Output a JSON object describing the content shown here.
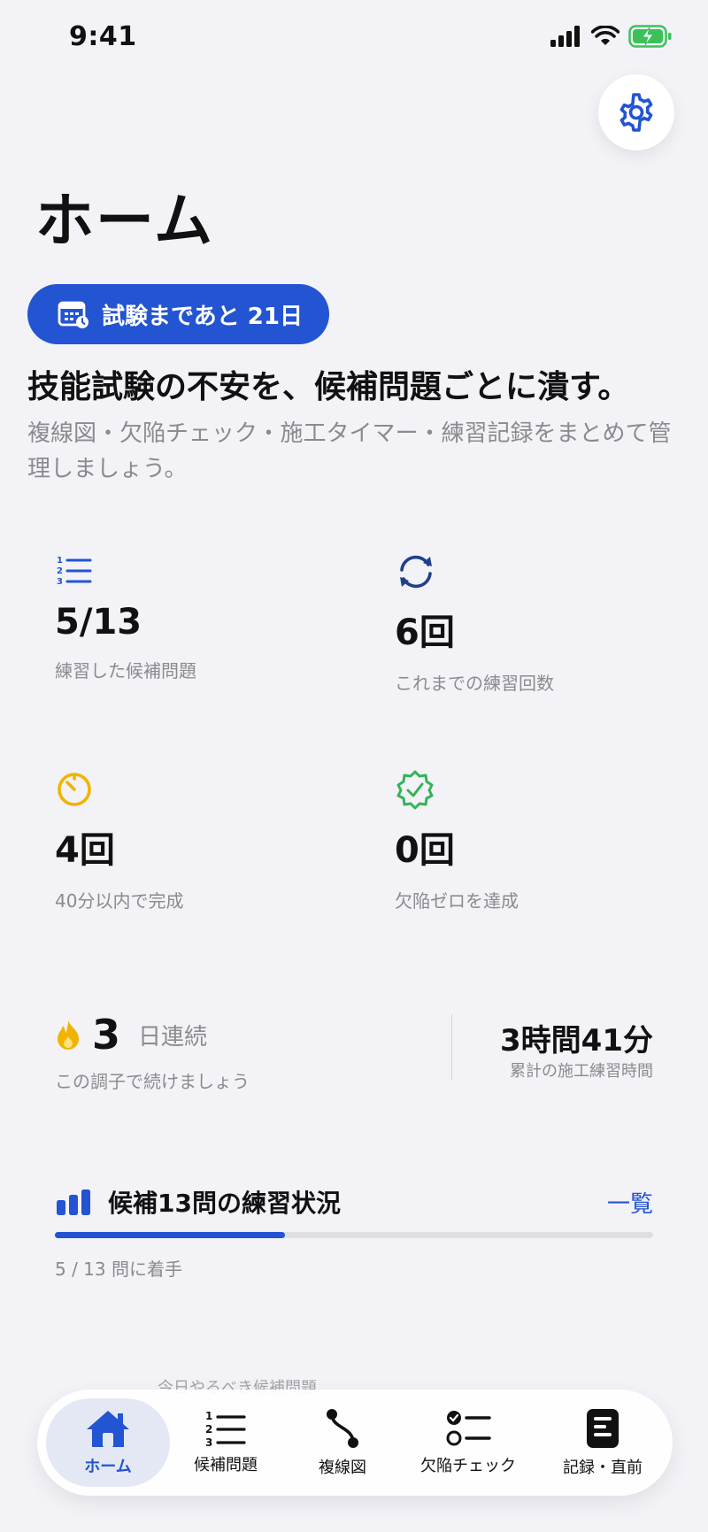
{
  "status_bar": {
    "time": "9:41"
  },
  "page": {
    "title": "ホーム"
  },
  "exam_badge": {
    "label": "試験まであと 21日"
  },
  "headline": "技能試験の不安を、候補問題ごとに潰す。",
  "subtext": "複線図・欠陥チェック・施工タイマー・練習記録をまとめて管理しましょう。",
  "stats": [
    {
      "icon": "numbered-list-icon",
      "value": "5/13",
      "label": "練習した候補問題",
      "color": "#2354d1"
    },
    {
      "icon": "refresh-icon",
      "value": "6回",
      "label": "これまでの練習回数",
      "color": "#1f3f8a"
    },
    {
      "icon": "timer-icon",
      "value": "4回",
      "label": "40分以内で完成",
      "color": "#f0b400"
    },
    {
      "icon": "verified-badge-icon",
      "value": "0回",
      "label": "欠陥ゼロを達成",
      "color": "#34b357"
    }
  ],
  "streak": {
    "count": "3",
    "unit": "日連続",
    "caption": "この調子で続けましょう"
  },
  "total_time": {
    "value": "3時間41分",
    "caption": "累計の施工練習時間"
  },
  "progress": {
    "title": "候補13問の練習状況",
    "link": "一覧",
    "caption": "5 / 13 問に着手",
    "fraction": 0.385
  },
  "today_peek": "今日やるべき候補問題",
  "tabs": [
    {
      "label": "ホーム",
      "icon": "house-icon",
      "active": true
    },
    {
      "label": "候補問題",
      "icon": "numbered-list-icon",
      "active": false
    },
    {
      "label": "複線図",
      "icon": "route-icon",
      "active": false
    },
    {
      "label": "欠陥チェック",
      "icon": "checklist-icon",
      "active": false
    },
    {
      "label": "記録・直前",
      "icon": "document-icon",
      "active": false
    }
  ],
  "colors": {
    "accent": "#2354d1",
    "background": "#f2f2f7",
    "muted": "#8a8a8f"
  }
}
